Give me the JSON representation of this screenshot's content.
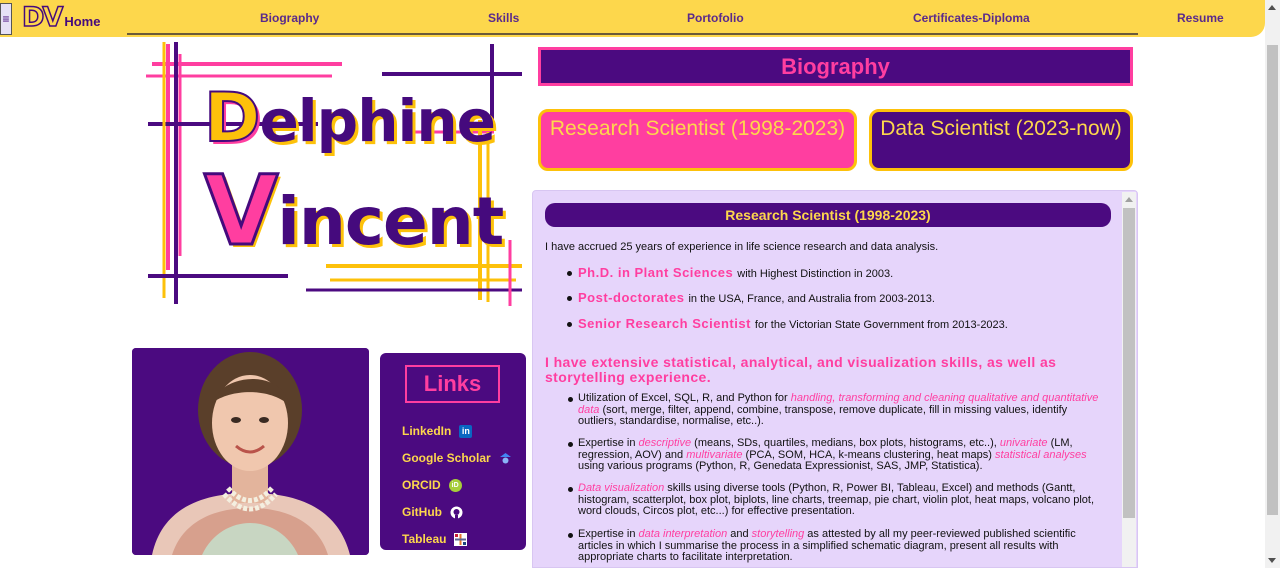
{
  "nav": {
    "brand": "DV",
    "home": "Home",
    "links": [
      "Biography",
      "Skills",
      "Portofolio",
      "Certificates-Diploma",
      "Resume"
    ]
  },
  "logo": {
    "first_initial": "D",
    "first_rest": "elphine",
    "last_initial": "V",
    "last_rest": "incent"
  },
  "links_card": {
    "title": "Links",
    "items": [
      {
        "label": "LinkedIn",
        "icon": "linkedin-icon",
        "icon_glyph": "in"
      },
      {
        "label": "Google Scholar",
        "icon": "google-scholar-icon",
        "icon_glyph": ""
      },
      {
        "label": "ORCID",
        "icon": "orcid-icon",
        "icon_glyph": "iD"
      },
      {
        "label": "GitHub",
        "icon": "github-icon",
        "icon_glyph": ""
      },
      {
        "label": "Tableau",
        "icon": "tableau-icon",
        "icon_glyph": ""
      }
    ]
  },
  "main": {
    "heading": "Biography",
    "tabs": [
      "Research Scientist (1998-2023)",
      "Data Scientist (2023-now)"
    ],
    "section_title": "Research Scientist (1998-2023)",
    "intro": "I have accrued 25 years of experience in life science research and data analysis.",
    "degrees": [
      {
        "em": "Ph.D. in Plant Sciences",
        "rest": "with Highest Distinction in 2003."
      },
      {
        "em": "Post-doctorates",
        "rest": "in the USA, France, and Australia from 2003-2013."
      },
      {
        "em": "Senior Research Scientist",
        "rest": "for the Victorian State Government from 2013-2023."
      }
    ],
    "skills_heading": "I have extensive statistical, analytical, and visualization skills, as well as storytelling experience.",
    "skills": [
      {
        "a": "Utilization of Excel, SQL, R, and Python for ",
        "h1": "handling, transforming and cleaning qualitative and quantitative data",
        "b": " (sort, merge, filter, append, combine, transpose, remove duplicate, fill in missing values, identify outliers, standardise, normalise, etc..)."
      },
      {
        "a": "Expertise in ",
        "h1": "descriptive",
        "b": " (means, SDs, quartiles, medians, box plots, histograms, etc..), ",
        "h2": "univariate",
        "c": " (LM, regression, AOV) and ",
        "h3": "multivariate",
        "d": " (PCA, SOM, HCA, k-means clustering, heat maps) ",
        "h4": "statistical analyses",
        "e": " using various programs (Python, R, Genedata Expressionist, SAS, JMP, Statistica)."
      },
      {
        "h1": "Data visualization",
        "b": " skills using diverse tools (Python, R, Power BI, Tableau, Excel) and methods (Gantt, histogram, scatterplot, box plot, biplots, line charts, treemap, pie chart, violin plot, heat maps, volcano plot, word clouds, Circos plot, etc...) for effective presentation."
      },
      {
        "a": "Expertise in ",
        "h1": "data interpretation",
        "b": " and ",
        "h2": "storytelling",
        "c": " as attested by all my peer-reviewed published scientific articles in which I summarise the process in a simplified schematic diagram, present all results with appropriate charts to facilitate interpretation."
      }
    ]
  },
  "colors": {
    "purple": "#4b0a80",
    "pink": "#ff3ea0",
    "yellow": "#fdd74c",
    "lavender": "#e6d5fb"
  }
}
